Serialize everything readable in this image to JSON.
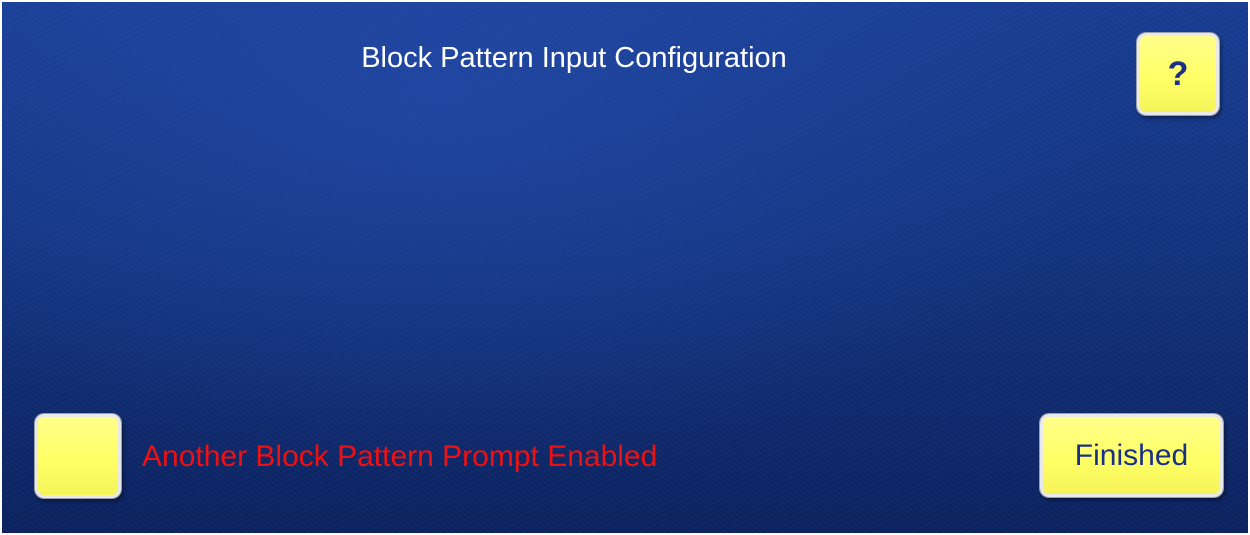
{
  "header": {
    "title": "Block Pattern Input Configuration"
  },
  "help_button": {
    "label": "?"
  },
  "prompt_option": {
    "label": "Another Block Pattern Prompt Enabled",
    "checked": false
  },
  "footer": {
    "finished_label": "Finished"
  },
  "colors": {
    "background": "#12337f",
    "button_fill": "#ffff66",
    "button_text": "#1a2f86",
    "title_text": "#ffffff",
    "prompt_text": "#ee1111"
  }
}
